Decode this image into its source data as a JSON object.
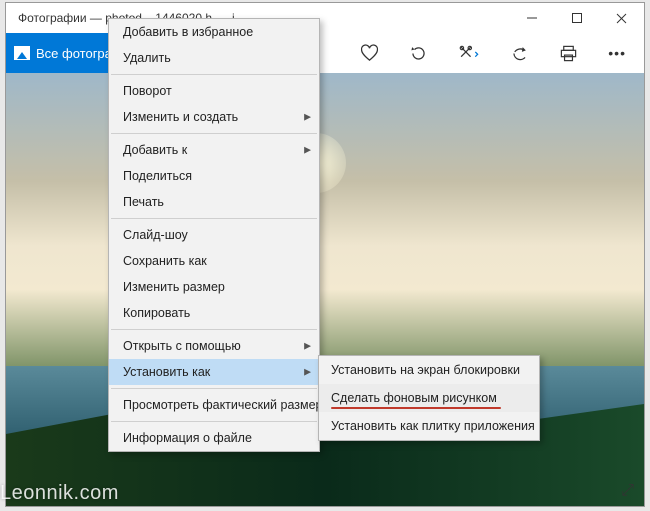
{
  "window_title": "Фотографии — photod... 1446020 h......i...",
  "all_photos_label": "Все фотографии",
  "watermark": "Leonnik.com",
  "context_menu": {
    "add_fav": "Добавить в избранное",
    "delete": "Удалить",
    "rotate": "Поворот",
    "edit_create": "Изменить и создать",
    "add_to": "Добавить к",
    "share": "Поделиться",
    "print": "Печать",
    "slideshow": "Слайд-шоу",
    "save_as": "Сохранить как",
    "resize": "Изменить размер",
    "copy": "Копировать",
    "open_with": "Открыть с помощью",
    "set_as": "Установить как",
    "actual_size": "Просмотреть фактический размер",
    "file_info": "Информация о файле"
  },
  "submenu": {
    "lock_screen": "Установить на экран блокировки",
    "background": "Сделать фоновым рисунком",
    "tile": "Установить как плитку приложения"
  }
}
